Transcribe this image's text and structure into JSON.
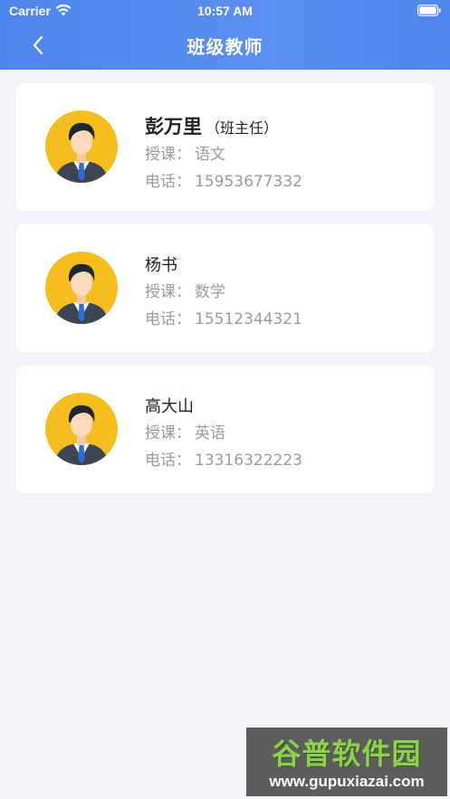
{
  "status_bar": {
    "carrier": "Carrier",
    "time": "10:57 AM",
    "wifi_icon": "wifi-icon",
    "battery_icon": "battery-icon"
  },
  "nav": {
    "title": "班级教师",
    "back_icon": "chevron-left-icon"
  },
  "teachers": [
    {
      "name": "彭万里",
      "role": "（班主任）",
      "subject_label": "授课：",
      "subject": "语文",
      "phone_label": "电话：",
      "phone": "15953677332",
      "avatar_icon": "teacher-avatar-icon"
    },
    {
      "name": "杨书",
      "role": "",
      "subject_label": "授课：",
      "subject": "数学",
      "phone_label": "电话：",
      "phone": "15512344321",
      "avatar_icon": "teacher-avatar-icon"
    },
    {
      "name": "高大山",
      "role": "",
      "subject_label": "授课：",
      "subject": "英语",
      "phone_label": "电话：",
      "phone": "13316322223",
      "avatar_icon": "teacher-avatar-icon"
    }
  ],
  "watermark": {
    "title": "谷普软件园",
    "url": "www.gupuxiazai.com"
  },
  "colors": {
    "header": "#5089ef",
    "background": "#f2f3f7",
    "avatar_bg": "#f6bd1e",
    "secondary_text": "#9b9b9b"
  }
}
